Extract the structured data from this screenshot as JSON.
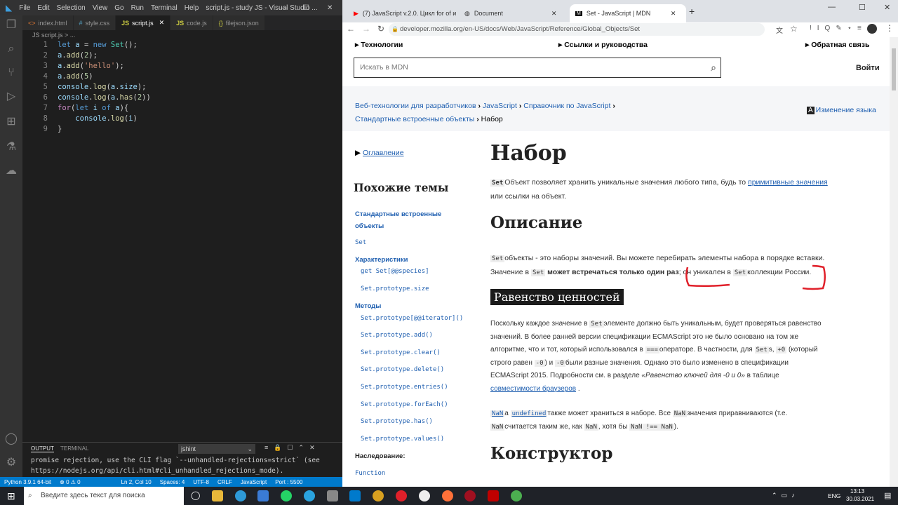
{
  "vscode": {
    "menu": [
      "File",
      "Edit",
      "Selection",
      "View",
      "Go",
      "Run",
      "Terminal",
      "Help"
    ],
    "title": "script.js - study JS - Visual Studio ...",
    "tabs": [
      "index.html",
      "style.css",
      "script.js",
      "code.js",
      "filejson.json"
    ],
    "breadcrumb": "JS script.js > ...",
    "line_numbers": [
      "1",
      "2",
      "3",
      "4",
      "5",
      "6",
      "7",
      "8",
      "9"
    ],
    "panel": {
      "tabs": [
        "OUTPUT",
        "TERMINAL"
      ],
      "select": "jshint",
      "line1": "promise rejection, use the CLI flag `--unhandled-rejections=strict` (see",
      "line2": "https://nodejs.org/api/cli.html#cli_unhandled_rejections_mode)."
    },
    "status": {
      "python": "Python 3.9.1 64-bit",
      "errors": "⊗ 0 ⚠ 0",
      "position": "Ln 2, Col 10",
      "spaces": "Spaces: 4",
      "encoding": "UTF-8",
      "eol": "CRLF",
      "lang": "JavaScript",
      "port": "Port : 5500"
    }
  },
  "chrome": {
    "tabs": [
      "(7) JavaScript v.2.0. Цикл for of и",
      "Document",
      "Set - JavaScript | MDN"
    ],
    "url": "developer.mozilla.org/en-US/docs/Web/JavaScript/Reference/Global_Objects/Set"
  },
  "mdn": {
    "nav": [
      "Технологии",
      "Ссылки и руководства",
      "Обратная связь"
    ],
    "search_placeholder": "Искать в MDN",
    "login": "Войти",
    "breadcrumb": [
      "Веб-технологии для разработчиков",
      "JavaScript",
      "Справочник по JavaScript",
      "Стандартные встроенные объекты",
      "Набор"
    ],
    "change_lang": "Изменение языка",
    "toc": "Оглавление",
    "sidebar": {
      "title": "Похожие темы",
      "std": "Стандартные встроенные объекты",
      "set": "Set",
      "props_h": "Характеристики",
      "props": [
        "get Set[@@species]",
        "Set.prototype.size"
      ],
      "methods_h": "Методы",
      "methods": [
        "Set.prototype[@@iterator]()",
        "Set.prototype.add()",
        "Set.prototype.clear()",
        "Set.prototype.delete()",
        "Set.prototype.entries()",
        "Set.prototype.forEach()",
        "Set.prototype.has()",
        "Set.prototype.values()"
      ],
      "inherit_h": "Наследование:",
      "inherit": "Function"
    },
    "h_main": "Набор",
    "intro_code": "Set",
    "intro_text": "Объект позволяет хранить уникальные значения любого типа, будь то",
    "intro_link": "примитивные значения",
    "intro_end": "или ссылки на объект.",
    "h_desc": "Описание",
    "desc1": "объекты - это наборы значений. Вы можете перебирать элементы набора в порядке вставки.",
    "desc2a": "Значение в",
    "desc2b": "может встречаться только один раз",
    "desc2c": "; он уникален в",
    "desc2d": "коллекции России.",
    "h_eq": "Равенство ценностей",
    "eq1": "Поскольку каждое значение в",
    "eq1b": "элементе должно быть уникальным, будет проверяться равенство",
    "eq2": "значений. В более ранней версии спецификации ECMAScript это не было основано на том же",
    "eq3a": "алгоритме, что и тот, который использовался в",
    "eq3b": "операторе. В частности, для",
    "eq3c": "s,",
    "eq3d": "(который",
    "eq4a": "строго равен",
    "eq4b": "и",
    "eq4c": "были разные значения. Однако это было изменено в спецификации",
    "eq5a": "ECMAScript 2015. Подробности см. в разделе",
    "eq5b": "«Равенство ключей для -0 и 0»",
    "eq5c": "в таблице",
    "eq6": "совместимости браузеров",
    "nan1a": "а",
    "nan1b": "также может храниться в наборе. Все",
    "nan1c": "значения приравниваются (т.е.",
    "nan2a": "считается таким же, как",
    "nan2b": ", хотя бы",
    "h_ctor": "Конструктор",
    "c_set": "Set",
    "c_strict": "===",
    "c_p0": "+0",
    "c_m0": "-0",
    "c_nan": "NaN",
    "c_undef": "undefined",
    "c_neq": "NaN !== NaN"
  },
  "taskbar": {
    "search": "Введите здесь текст для поиска",
    "lang": "ENG",
    "time": "13:13",
    "date": "30.03.2021"
  },
  "colors": {
    "vs_status": "#007acc",
    "mdn_link": "#1f5fb0",
    "annotation": "#e0202a"
  }
}
